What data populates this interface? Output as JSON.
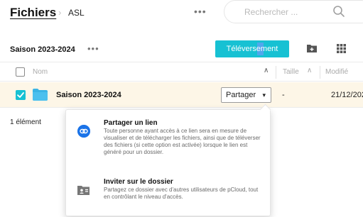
{
  "breadcrumb": {
    "root": "Fichiers",
    "separator": "›",
    "current": "ASL"
  },
  "header": {
    "more_label": "•••",
    "search": {
      "placeholder": "Rechercher ...",
      "icon": "search-icon"
    }
  },
  "toolbar": {
    "folder_title": "Saison 2023-2024",
    "more_label": "•••",
    "upload_label": "Téléversement",
    "new_folder_icon": "new-folder-icon",
    "view_icon": "grid-view-icon"
  },
  "table": {
    "columns": [
      {
        "label": "Nom",
        "sort_indicator": "∧"
      },
      {
        "label": "Taille",
        "sort_indicator": "∧"
      },
      {
        "label": "Modifié"
      }
    ],
    "rows": [
      {
        "checked": true,
        "icon": "folder-icon",
        "name": "Saison 2023-2024",
        "share_label": "Partager",
        "share_caret": "▾",
        "size": "-",
        "modified": "21/12/202"
      }
    ]
  },
  "footer": {
    "item_count": "1 élément"
  },
  "share_menu": {
    "options": [
      {
        "icon": "link-icon",
        "title": "Partager un lien",
        "description": "Toute personne ayant accès à ce lien sera en mesure de visualiser et de télécharger les fichiers, ainsi que de téléverser des fichiers (si cette option est activée) lorsque le lien est généré pour un dossier."
      },
      {
        "icon": "invite-user-icon",
        "title": "Inviter sur le dossier",
        "description": "Partagez ce dossier avec d'autres utilisateurs de pCloud, tout en contrôlant le niveau d'accès."
      }
    ]
  },
  "colors": {
    "accent": "#17c1d3",
    "selected_row": "#fdf6e7",
    "folder": "#3bb4e5",
    "link_icon": "#1a73e8",
    "muted_text": "#aaaaaa"
  }
}
